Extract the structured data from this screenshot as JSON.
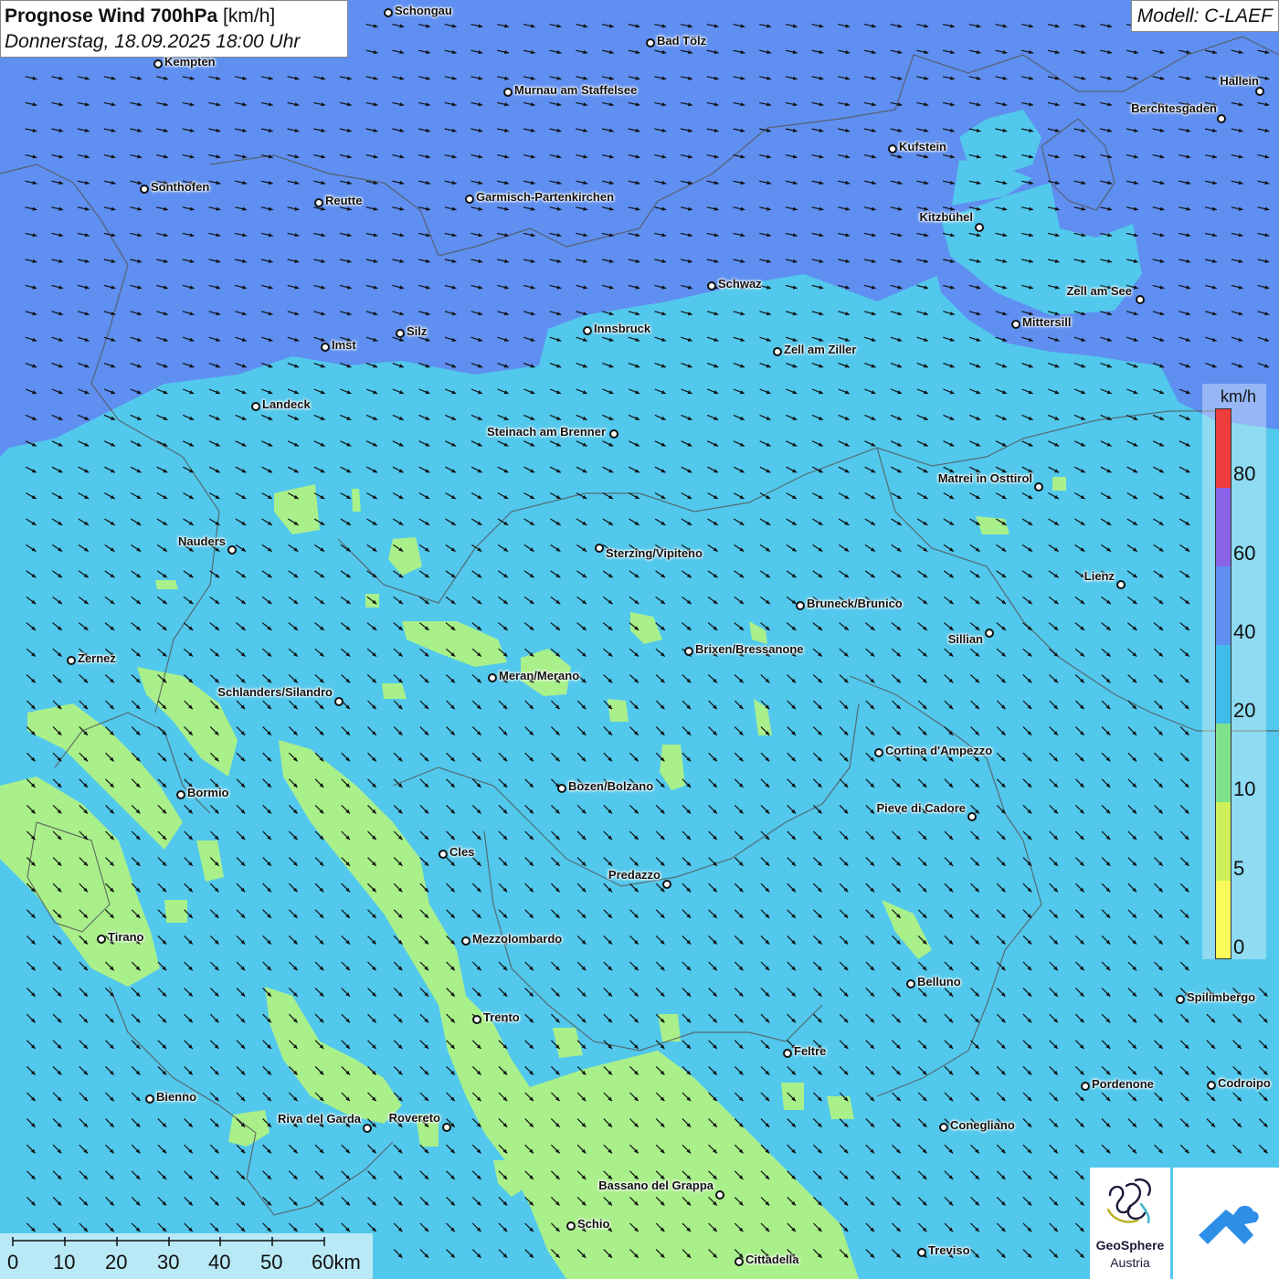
{
  "header": {
    "title_bold": "Prognose Wind 700hPa",
    "title_unit": "[km/h]",
    "subtitle": "Donnerstag, 18.09.2025 18:00 Uhr",
    "model": "Modell: C-LAEF"
  },
  "legend": {
    "unit": "km/h",
    "ticks": [
      "80",
      "60",
      "40",
      "20",
      "10",
      "5",
      "0"
    ],
    "colors": [
      "#ee3b3b",
      "#8a62e8",
      "#5f8ef0",
      "#3fbcea",
      "#7ee28a",
      "#cdf05a",
      "#fafa5a"
    ]
  },
  "map_colors": {
    "band_0_10": "#a9f08a",
    "band_10_20": "#52c8ec",
    "band_20_40": "#5f8ff0",
    "arrow": "#111111",
    "border": "#555555"
  },
  "wind": {
    "north_direction": "east-southeast",
    "south_direction": "southeast"
  },
  "cities": [
    {
      "name": "Schongau"
    },
    {
      "name": "Bad Tölz"
    },
    {
      "name": "Kempten"
    },
    {
      "name": "Murnau am Staffelsee"
    },
    {
      "name": "Hallein"
    },
    {
      "name": "Berchtesgaden"
    },
    {
      "name": "Kufstein"
    },
    {
      "name": "Sonthofen"
    },
    {
      "name": "Reutte"
    },
    {
      "name": "Garmisch-Partenkirchen"
    },
    {
      "name": "Kitzbühel"
    },
    {
      "name": "Schwaz"
    },
    {
      "name": "Zell am See"
    },
    {
      "name": "Mittersill"
    },
    {
      "name": "Silz"
    },
    {
      "name": "Innsbruck"
    },
    {
      "name": "Imst"
    },
    {
      "name": "Zell am Ziller"
    },
    {
      "name": "Landeck"
    },
    {
      "name": "Steinach am Brenner"
    },
    {
      "name": "Matrei in Osttirol"
    },
    {
      "name": "Nauders"
    },
    {
      "name": "Sterzing/Vipiteno"
    },
    {
      "name": "Lienz"
    },
    {
      "name": "Bruneck/Brunico"
    },
    {
      "name": "Sillian"
    },
    {
      "name": "Zernez"
    },
    {
      "name": "Brixen/Bressanone"
    },
    {
      "name": "Meran/Merano"
    },
    {
      "name": "Schlanders/Silandro"
    },
    {
      "name": "Cortina d'Ampezzo"
    },
    {
      "name": "Bozen/Bolzano"
    },
    {
      "name": "Bormio"
    },
    {
      "name": "Pieve di Cadore"
    },
    {
      "name": "Cles"
    },
    {
      "name": "Predazzo"
    },
    {
      "name": "Tirano"
    },
    {
      "name": "Mezzolombardo"
    },
    {
      "name": "Belluno"
    },
    {
      "name": "Spilimbergo"
    },
    {
      "name": "Trento"
    },
    {
      "name": "Feltre"
    },
    {
      "name": "Pordenone"
    },
    {
      "name": "Codroipo"
    },
    {
      "name": "Bienno"
    },
    {
      "name": "Riva del Garda"
    },
    {
      "name": "Rovereto"
    },
    {
      "name": "Conegliano"
    },
    {
      "name": "Bassano del Grappa"
    },
    {
      "name": "Schio"
    },
    {
      "name": "Treviso"
    },
    {
      "name": "Cittadella"
    }
  ],
  "scalebar": {
    "labels": [
      "0",
      "10",
      "20",
      "30",
      "40",
      "50",
      "60km"
    ]
  },
  "logo": {
    "line1": "GeoSphere",
    "line2": "Austria"
  }
}
